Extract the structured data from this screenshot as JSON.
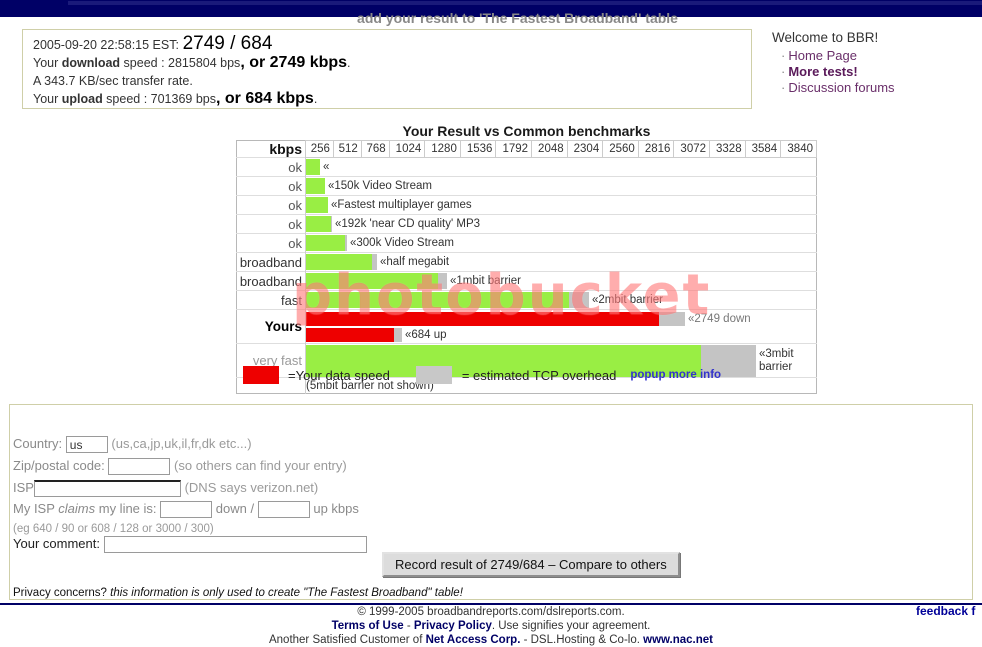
{
  "header": {
    "bar_color": "#000066"
  },
  "result": {
    "timestamp": "2005-09-20 22:58:15 EST:",
    "summary": "2749 / 684",
    "download_prefix": "Your ",
    "download_word": "download",
    "download_mid": " speed : 2815804 bps",
    "download_or": ", or 2749 kbps",
    "download_end": ".",
    "transfer_rate": "A 343.7 KB/sec transfer rate.",
    "upload_prefix": "Your ",
    "upload_word": "upload",
    "upload_mid": " speed : 701369 bps",
    "upload_or": ", or 684 kbps",
    "upload_end": "."
  },
  "welcome": {
    "title": "Welcome to BBR!",
    "links": [
      {
        "label": "Home Page",
        "strong": false
      },
      {
        "label": "More tests!",
        "strong": true
      },
      {
        "label": "Discussion forums",
        "strong": false
      }
    ]
  },
  "chart_data": {
    "type": "bar",
    "title": "Your Result vs Common benchmarks",
    "xlabel": "kbps",
    "ylabel": "",
    "axis_label": "kbps",
    "ticks": [
      256,
      512,
      768,
      1024,
      1280,
      1536,
      1792,
      2048,
      2304,
      2560,
      2816,
      3072,
      3328,
      3584,
      3840
    ],
    "xlim": [
      0,
      3968
    ],
    "grid": true,
    "legend": [
      {
        "label": "=Your data speed",
        "color": "#ee0000"
      },
      {
        "label": "= estimated TCP overhead",
        "color": "#c8c8c8"
      }
    ],
    "popup_link": "popup more info",
    "note": "(5mbit barrier not shown)",
    "rows": [
      {
        "label": "ok",
        "data": 110,
        "overhead": 0,
        "annotation": "«",
        "color": "#99ee44",
        "type": "benchmark"
      },
      {
        "label": "ok",
        "data": 150,
        "overhead": 0,
        "annotation": "«150k Video Stream",
        "color": "#99ee44",
        "type": "benchmark"
      },
      {
        "label": "ok",
        "data": 170,
        "overhead": 0,
        "annotation": "«Fastest multiplayer games",
        "color": "#99ee44",
        "type": "benchmark"
      },
      {
        "label": "ok",
        "data": 192,
        "overhead": 14,
        "annotation": "«192k 'near CD quality' MP3",
        "color": "#99ee44",
        "type": "benchmark"
      },
      {
        "label": "ok",
        "data": 300,
        "overhead": 22,
        "annotation": "«300k Video Stream",
        "color": "#99ee44",
        "type": "benchmark"
      },
      {
        "label": "broadband",
        "data": 512,
        "overhead": 38,
        "annotation": "«half megabit",
        "color": "#99ee44",
        "type": "benchmark"
      },
      {
        "label": "broadband",
        "data": 1024,
        "overhead": 76,
        "annotation": "«1mbit barrier",
        "color": "#99ee44",
        "type": "benchmark"
      },
      {
        "label": "fast",
        "data": 2048,
        "overhead": 150,
        "annotation": "«2mbit barrier",
        "color": "#99ee44",
        "type": "benchmark"
      },
      {
        "label": "Yours",
        "data": 2749,
        "overhead": 200,
        "annotation": "«2749 down",
        "color": "#ee0000",
        "type": "yours-down"
      },
      {
        "label": "Yours",
        "data": 684,
        "overhead": 60,
        "annotation": "«684 up",
        "color": "#ee0000",
        "type": "yours-up"
      },
      {
        "label": "very fast",
        "data": 3072,
        "overhead": 430,
        "annotation": "«3mbit barrier",
        "color": "#99ee44",
        "type": "benchmark"
      }
    ]
  },
  "watermark": {
    "text": "photobucket"
  },
  "form": {
    "heading": "add your result to 'The Fastest Broadband' table",
    "country_label": "Country:",
    "country_value": "us",
    "country_hint": "(us,ca,jp,uk,il,fr,dk etc...)",
    "zip_label": "Zip/postal code:",
    "zip_value": "",
    "zip_hint": "(so others can find your entry)",
    "isp_label": "ISP",
    "isp_value": "",
    "isp_hint": "(DNS says verizon.net)",
    "claims_label": "My ISP ",
    "claims_italic": "claims",
    "claims_label2": " my line is:",
    "claims_down_value": "",
    "claims_mid": "down /",
    "claims_up_value": "",
    "claims_end": "up kbps",
    "claims_example": "(eg 640 / 90 or 608 / 128 or 3000 / 300)",
    "comment_label": "Your comment:",
    "comment_value": "",
    "submit_label": "Record result of 2749/684 – Compare to others",
    "privacy_lead": "Privacy concerns?",
    "privacy_italic": "this information is only used to create \"The Fastest Broadband\" table!"
  },
  "footer": {
    "line1": "© 1999-2005 broadbandreports.com/dslreports.com.",
    "line2_a": "Terms of Use",
    "line2_sep": " - ",
    "line2_b": "Privacy Policy",
    "line2_c": ". Use signifies your agreement.",
    "line3_a": "Another Satisfied Customer of ",
    "line3_b": "Net Access Corp.",
    "line3_c": " - DSL.Hosting & Co-lo. ",
    "line3_d": "www.nac.net",
    "feedback": "feedback f"
  }
}
